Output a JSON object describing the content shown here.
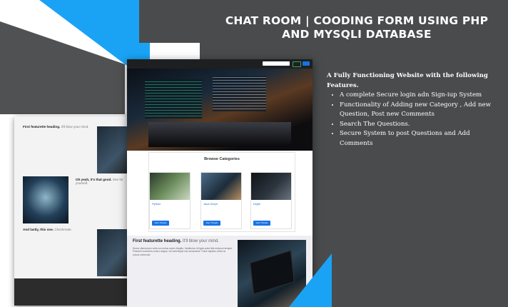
{
  "title": {
    "line1": "CHAT ROOM | COODING FORM USING PHP",
    "line2": "AND MYSQLI DATABASE"
  },
  "features": {
    "heading": "A Fully Functioning Website with the following Features.",
    "items": [
      "A complete Secure login adn Sign-iup System",
      "Functionality of Adding new Category , Add new Question,  Post new Comments",
      "Search The Questions.",
      "Secure System to post Questions and Add Comments"
    ]
  },
  "back_mockup": {
    "row1_heading": "First featurette heading.",
    "row1_tagline": "It'll blow your mind.",
    "row2_heading": "Oh yeah, it's that good.",
    "row2_tagline": "See for yourself.",
    "row3_heading": "And lastly, this one.",
    "row3_tagline": "Checkmate."
  },
  "front_mockup": {
    "browse_title": "Browse Categories",
    "categories": [
      {
        "name": "Python",
        "button": "View Threads"
      },
      {
        "name": "Java Script",
        "button": "View Threads"
      },
      {
        "name": "Dejlle",
        "button": "View Threads"
      }
    ],
    "feature_heading": "First featurette heading.",
    "feature_tagline": "It'll blow your mind.",
    "feature_text": "Donec ullamcorper nulla non metus auctor fringilla. Vestibulum id ligula porta felis euismod semper. Praesent commodo cursus magna, vel scelerisque nisl consectetur. Fusce dapibus, tellus ac cursus commodo."
  },
  "colors": {
    "accent_blue": "#1aa3f5",
    "background_dark": "#4a4b4d",
    "button_blue": "#1673e6"
  }
}
